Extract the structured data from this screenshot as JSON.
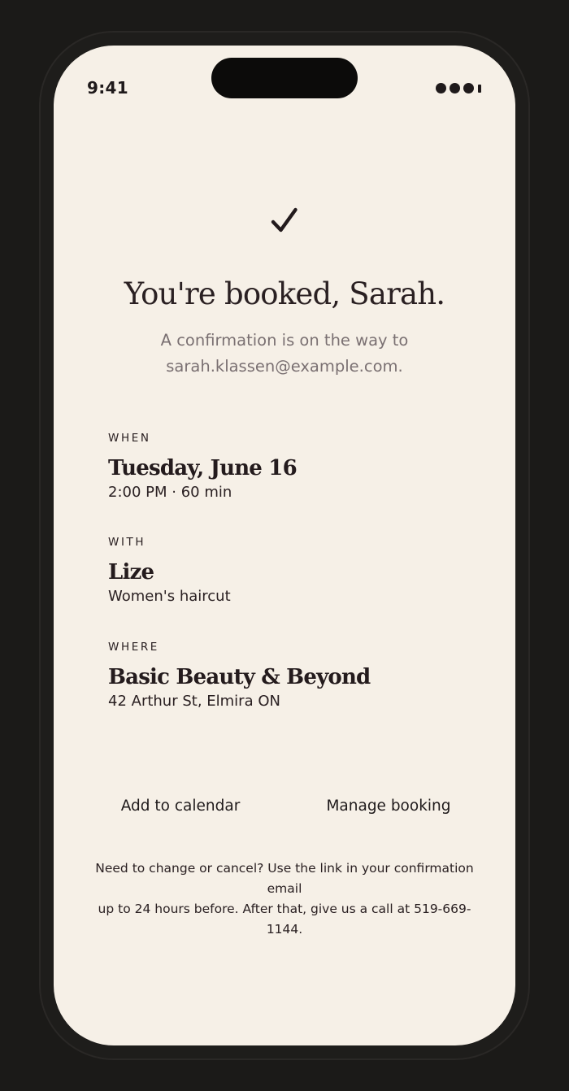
{
  "status_bar": {
    "time": "9:41"
  },
  "confirmation": {
    "icon": "checkmark-icon",
    "title": "You're booked, Sarah.",
    "subtitle_line1": "A confirmation is on the way to",
    "subtitle_line2": "sarah.klassen@example.com."
  },
  "details": {
    "when": {
      "label": "WHEN",
      "value": "Tuesday, June 16",
      "detail": "2:00 PM · 60 min"
    },
    "with": {
      "label": "WITH",
      "value": "Lize",
      "detail": "Women's haircut"
    },
    "where": {
      "label": "WHERE",
      "value": "Basic Beauty & Beyond",
      "detail": "42 Arthur St, Elmira ON"
    }
  },
  "actions": {
    "add_to_calendar": "Add to calendar",
    "manage_booking": "Manage booking"
  },
  "note": {
    "line1": "Need to change or cancel? Use the link in your confirmation email",
    "line2": "up to 24 hours before. After that, give us a call at 519-669-1144."
  },
  "colors": {
    "background": "#1b1a18",
    "screen": "#f6f0e7",
    "text": "#241b1d",
    "muted": "#7a7072"
  }
}
